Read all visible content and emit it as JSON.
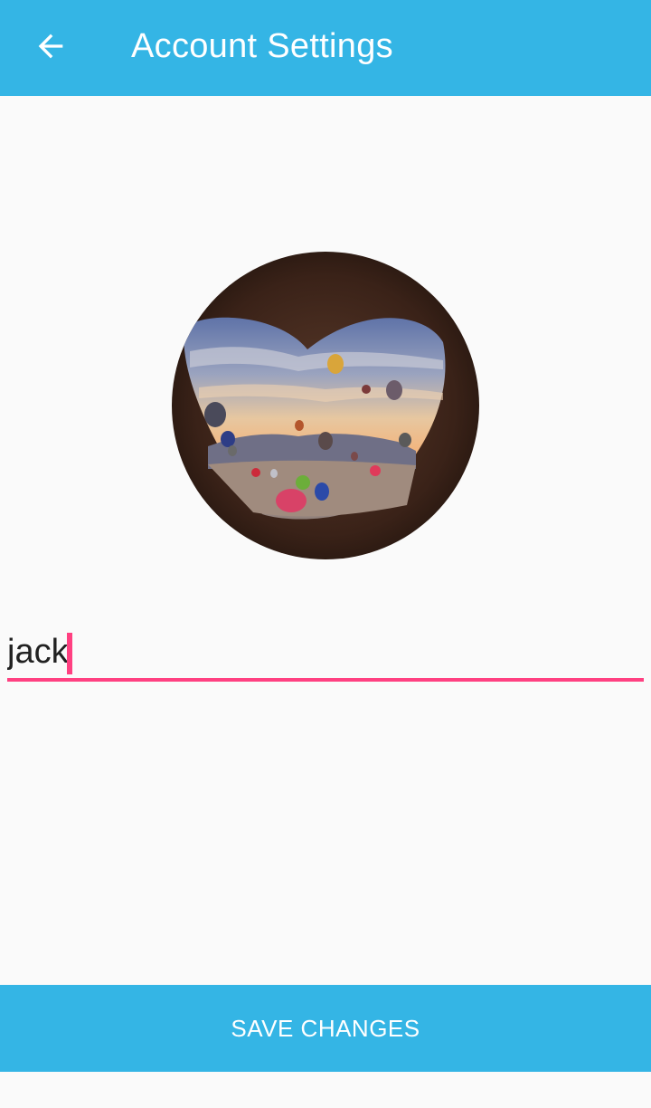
{
  "app_bar": {
    "title": "Account Settings",
    "back_icon": "arrow-back-icon"
  },
  "profile": {
    "avatar_image": "heart-shaped cave opening with hot air balloons over valley"
  },
  "name_field": {
    "value": "jack",
    "placeholder": ""
  },
  "actions": {
    "save_label": "SAVE CHANGES"
  },
  "colors": {
    "primary": "#34b5e5",
    "accent": "#ff4081",
    "background": "#fafafa",
    "text": "#212121"
  }
}
